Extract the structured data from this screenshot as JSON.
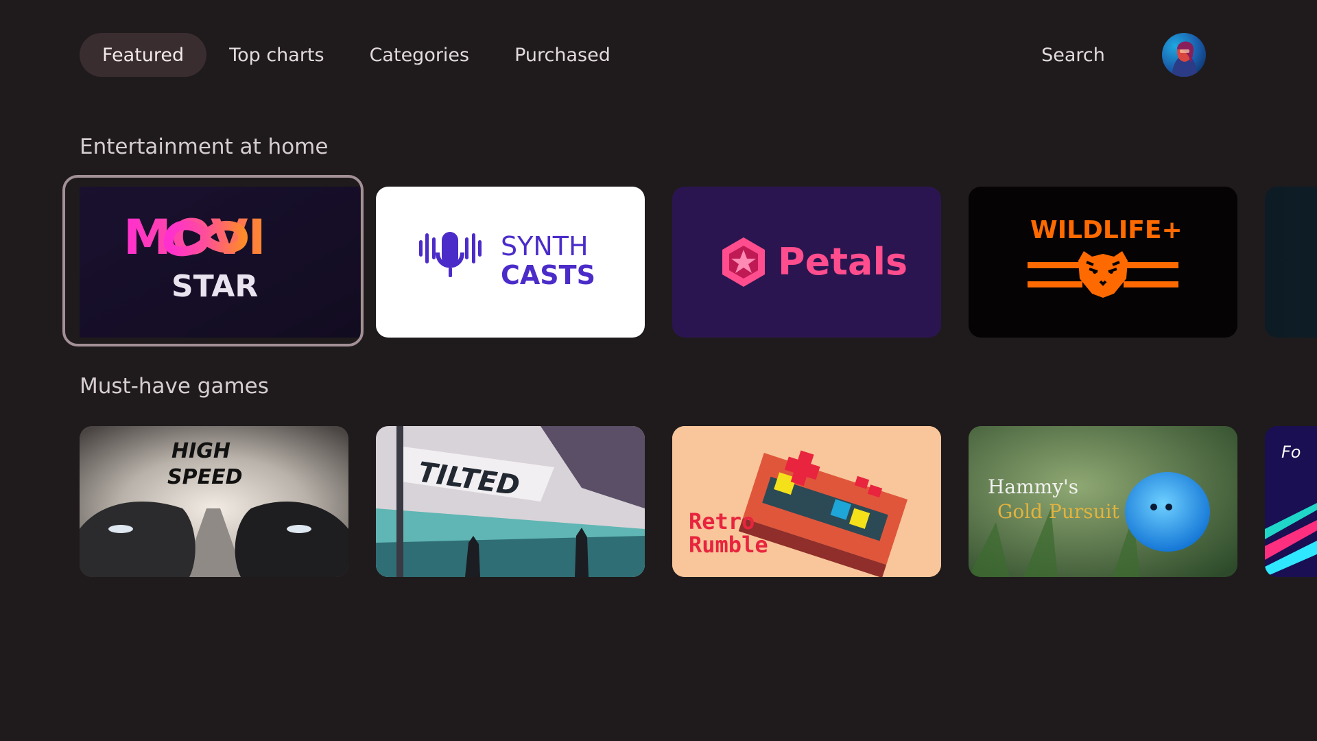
{
  "nav": {
    "tabs": [
      {
        "label": "Featured"
      },
      {
        "label": "Top charts"
      },
      {
        "label": "Categories"
      },
      {
        "label": "Purchased"
      }
    ],
    "search_label": "Search"
  },
  "sections": [
    {
      "title": "Entertainment at home",
      "cards": [
        {
          "lines": [
            "MOVI",
            "STAR"
          ]
        },
        {
          "lines": [
            "SYNTH",
            "CASTS"
          ]
        },
        {
          "lines": [
            "Petals"
          ]
        },
        {
          "lines": [
            "WILDLIFE+"
          ]
        }
      ]
    },
    {
      "title": "Must-have games",
      "cards": [
        {
          "lines": [
            "HIGH",
            "SPEED"
          ]
        },
        {
          "lines": [
            "TILTED"
          ]
        },
        {
          "lines": [
            "Retro",
            "Rumble"
          ]
        },
        {
          "lines": [
            "Hammy's",
            "Gold Pursuit"
          ]
        },
        {
          "lines": [
            "Fo"
          ]
        }
      ]
    }
  ],
  "colors": {
    "background": "#1f1b1c",
    "active_tab": "#3a2d30",
    "focus_ring": "#a39096",
    "wildlife_orange": "#ff6a00",
    "petals_pink": "#ff4d8d",
    "synth_purple": "#4b2cc9"
  }
}
